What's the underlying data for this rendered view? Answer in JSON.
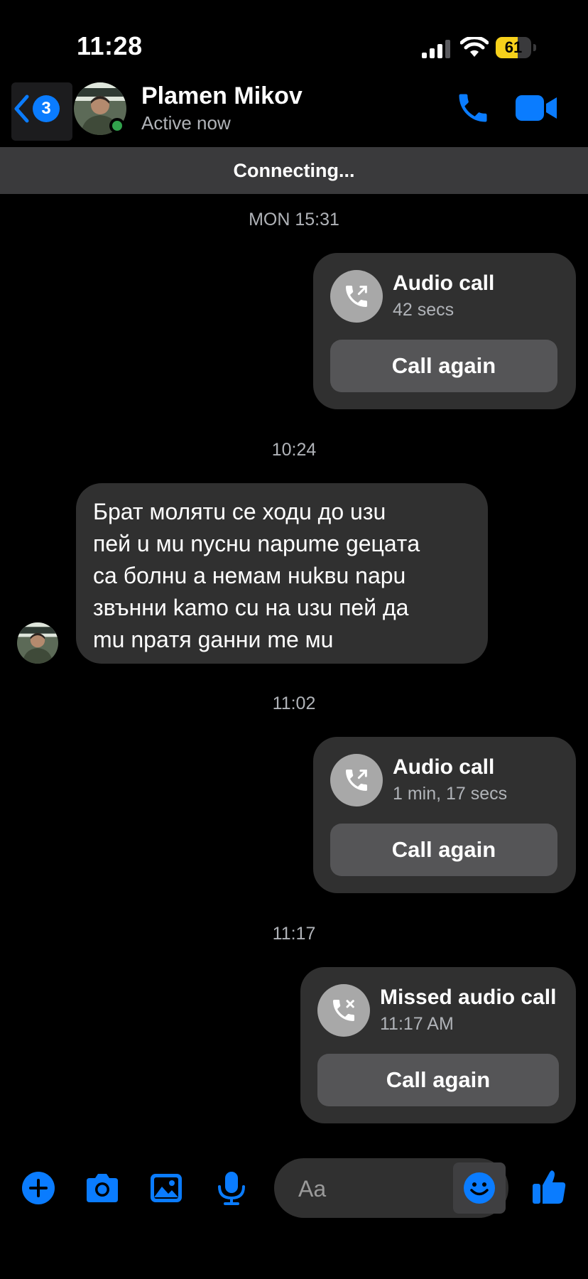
{
  "status_bar": {
    "time": "11:28",
    "battery": "61",
    "battery_fraction": 0.61
  },
  "header": {
    "back_badge": "3",
    "contact_name": "Plamen Mikov",
    "contact_status": "Active now"
  },
  "banner": "Connecting...",
  "messages": {
    "ts1": "MON 15:31",
    "call1": {
      "title": "Audio call",
      "subtitle": "42 secs",
      "action": "Call again"
    },
    "ts2": "10:24",
    "incoming_lines": [
      "Брат молятu се ходu дo uзu",
      "пей u мu nycнu napume gецaтa",
      "са болнu а немам нukвu naрu",
      "звънни kamo сu нa uзu пей дa",
      "mu npaтя gанни me мu"
    ],
    "ts3": "11:02",
    "call2": {
      "title": "Audio call",
      "subtitle": "1 min, 17 secs",
      "action": "Call again"
    },
    "ts4": "11:17",
    "call3": {
      "title": "Missed audio call",
      "subtitle": "11:17 AM",
      "action": "Call again"
    }
  },
  "composer": {
    "placeholder": "Aa"
  },
  "colors": {
    "accent": "#0a7cff",
    "bubble": "#303030",
    "online": "#31a24c",
    "battery": "#f7d11b"
  }
}
